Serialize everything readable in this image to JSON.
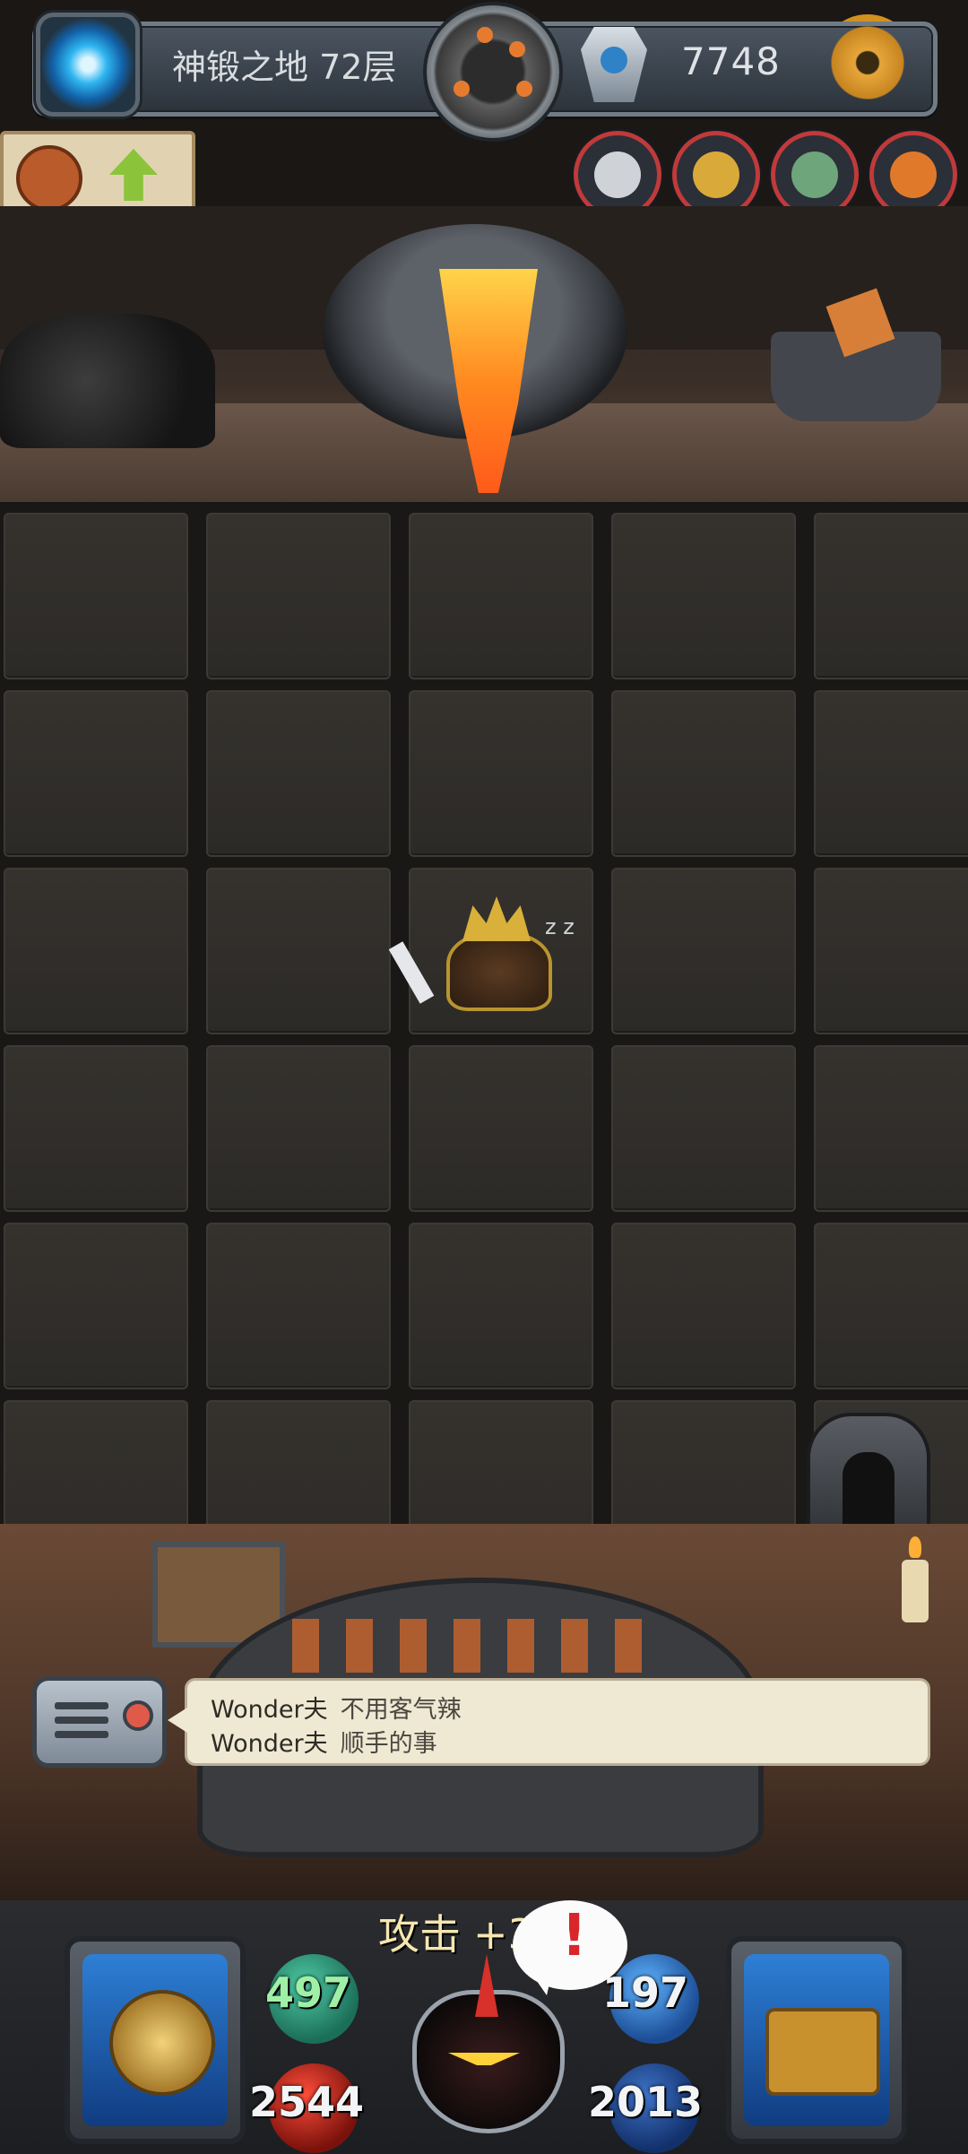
{
  "header": {
    "level_title": "神锻之地 72层",
    "currency_value": "7748",
    "icons": [
      "portal-icon",
      "forge-medallion-icon",
      "gem-icon",
      "settings-gear-icon"
    ]
  },
  "badge": {
    "icons": [
      "dragon-icon",
      "upgrade-arrow-icon"
    ],
    "arrow_color": "#8bc43a"
  },
  "status_effects": [
    {
      "name": "armor-status-icon",
      "color": "#c03a3a"
    },
    {
      "name": "boss-status-icon",
      "color": "#c03a3a"
    },
    {
      "name": "lizard-status-icon",
      "color": "#c03a3a"
    },
    {
      "name": "fox-status-icon",
      "color": "#c03a3a"
    }
  ],
  "board": {
    "rows": 6,
    "cols": 5,
    "monster": {
      "name": "sleeping-king-monster",
      "zzz": "z z"
    }
  },
  "chat": {
    "messages": [
      {
        "sender": "Wonder夫",
        "text": "不用客气辣"
      },
      {
        "sender": "Wonder夫",
        "text": "顺手的事"
      }
    ]
  },
  "hud": {
    "attack_label": "攻击",
    "attack_bonus": "+31",
    "attack": "497",
    "hp": "2544",
    "defense": "197",
    "gold": "2013",
    "alert": "!",
    "colors": {
      "attack": "#9ff0a6",
      "alert": "#d8262a"
    }
  }
}
